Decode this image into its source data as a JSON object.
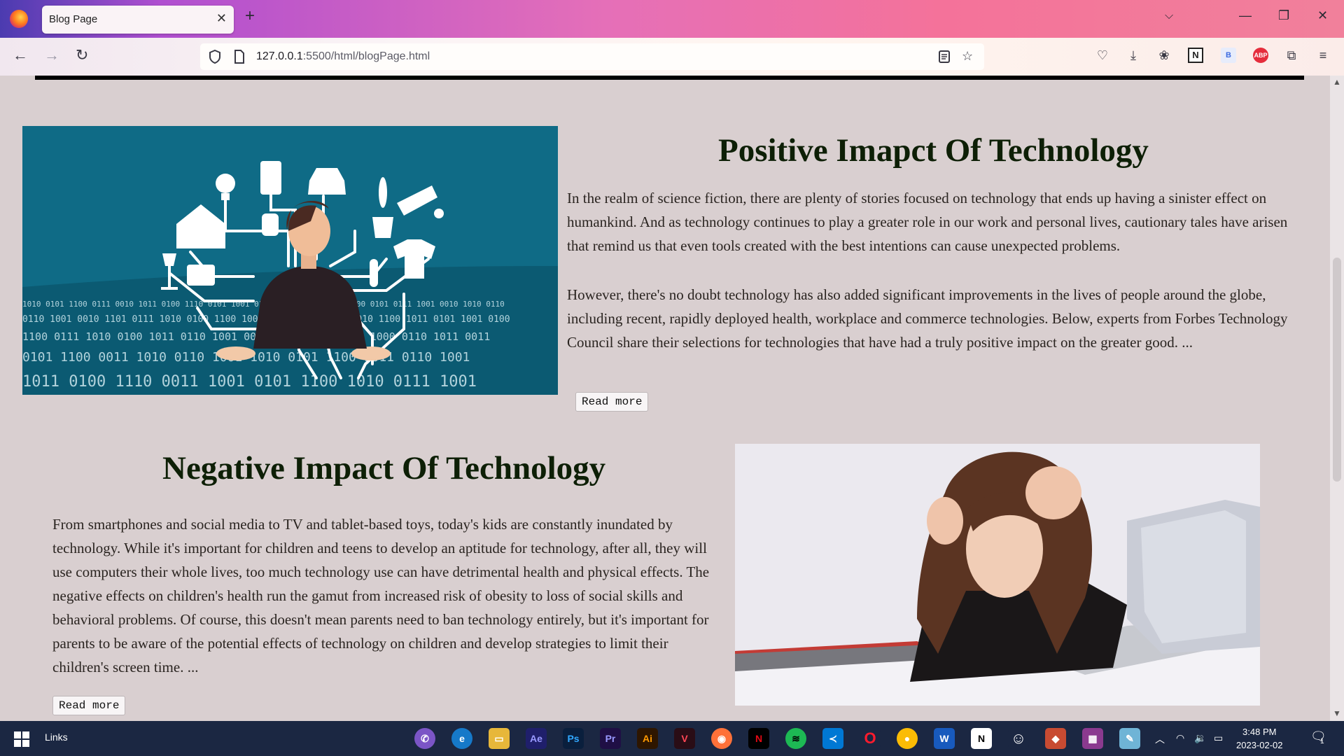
{
  "browser": {
    "tab_title": "Blog Page",
    "url_host": "127.0.0.1",
    "url_path": ":5500/html/blogPage.html"
  },
  "posts": [
    {
      "title": "Positive Imapct Of Technology",
      "paragraph_1": "In the realm of science fiction, there are plenty of stories focused on technology that ends up having a sinister effect on humankind. And as technology continues to play a greater role in our work and personal lives, cautionary tales have arisen that remind us that even tools created with the best intentions can cause unexpected problems.",
      "paragraph_2": "However, there's no doubt technology has also added significant improvements in the lives of people around the globe, including recent, rapidly deployed health, workplace and commerce technologies. Below, experts from Forbes Technology Council share their selections for technologies that have had a truly positive impact on the greater good. ...",
      "button": "Read more"
    },
    {
      "title": "Negative Impact Of Technology",
      "paragraph_1": "From smartphones and social media to TV and tablet-based toys, today's kids are constantly inundated by technology. While it's important for children and teens to develop an aptitude for technology, after all, they will use computers their whole lives, too much technology use can have detrimental health and physical effects. The negative effects on children's health run the gamut from increased risk of obesity to loss of social skills and behavioral problems. Of course, this doesn't mean parents need to ban technology entirely, but it's important for parents to be aware of the potential effects of technology on children and develop strategies to limit their children's screen time. ...",
      "button": "Read more"
    }
  ],
  "taskbar": {
    "links_label": "Links",
    "apps": [
      "Ae",
      "Ps",
      "Pr",
      "Ai"
    ],
    "time": "3:48 PM",
    "date": "2023-02-02"
  },
  "tray": {
    "notification_count": "1"
  }
}
